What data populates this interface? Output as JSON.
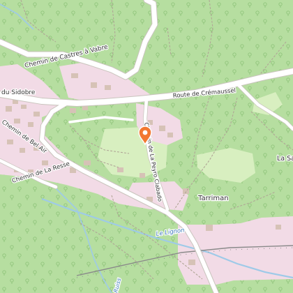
{
  "map": {
    "colors": {
      "forest": "#b6dea0",
      "meadow": "#d8efc0",
      "residential": "#f2dbe6",
      "building": "#d6c2b6",
      "road": "#ffffff",
      "road_casing": "#c9c4bd",
      "water": "#9ecae8",
      "track": "#b0a696",
      "railway": "#8a8a8a",
      "marker": "#f27830"
    },
    "labels": {
      "chemin_castres_vabre": "Chemin de Castres à Vabre",
      "route_cremaussel": "Route de Crémaussel",
      "du_sidobre": "du Sidobre",
      "chemin_bel_air": "Chemin de Bel Air",
      "chemin_la_resse": "Chemin de La Resse",
      "chemin_peyro_clabado": "Chemin de La Peyro Clabado",
      "tarriman": "Tarriman",
      "la_sa": "La Sa",
      "le_lignon": "Le Lignon",
      "ruisseau": "Ruiss"
    },
    "marker": {
      "icon": "map-pin-icon"
    }
  }
}
